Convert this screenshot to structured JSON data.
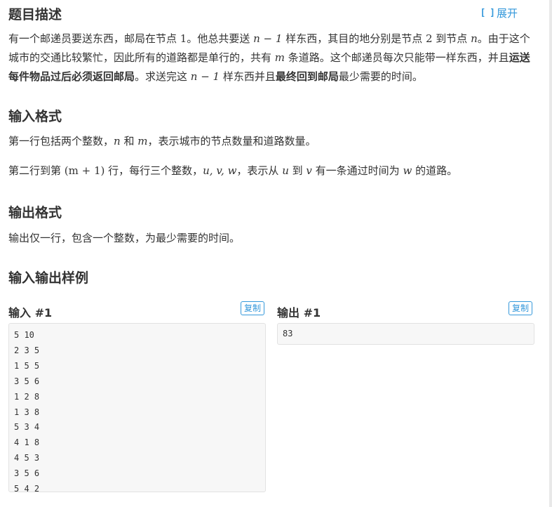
{
  "expand_label": "展开",
  "sections": {
    "description": {
      "title": "题目描述",
      "p1_a": "有一个邮递员要送东西，邮局在节点 ",
      "p1_m1": "1",
      "p1_b": "。他总共要送 ",
      "p1_m2": "n − 1",
      "p1_c": " 样东西，其目的地分别是节点 ",
      "p1_m3": "2",
      "p1_d": " 到节点 ",
      "p1_m4": "n",
      "p1_e": "。由于这个城市的交通比较繁忙，因此所有的道路都是单行的，共有 ",
      "p1_m5": "m",
      "p1_f": " 条道路。这个邮递员每次只能带一样东西，并且",
      "p1_bold1": "运送每件物品过后必须返回邮局",
      "p1_g": "。求送完这 ",
      "p1_m6": "n − 1",
      "p1_h": " 样东西并且",
      "p1_bold2": "最终回到邮局",
      "p1_i": "最少需要的时间。"
    },
    "input_format": {
      "title": "输入格式",
      "l1_a": "第一行包括两个整数，",
      "l1_m1": "n",
      "l1_b": " 和 ",
      "l1_m2": "m",
      "l1_c": "，表示城市的节点数量和道路数量。",
      "l2_a": "第二行到第 ",
      "l2_m1": "(m + 1)",
      "l2_b": " 行，每行三个整数，",
      "l2_m2": "u, v, w",
      "l2_c": "，表示从 ",
      "l2_m3": "u",
      "l2_d": " 到 ",
      "l2_m4": "v",
      "l2_e": " 有一条通过时间为 ",
      "l2_m5": "w",
      "l2_f": " 的道路。"
    },
    "output_format": {
      "title": "输出格式",
      "text": "输出仅一行，包含一个整数，为最少需要的时间。"
    },
    "samples": {
      "title": "输入输出样例",
      "input_label": "输入 #1",
      "output_label": "输出 #1",
      "copy_label": "复制",
      "input_text": "5 10\n2 3 5\n1 5 5\n3 5 6\n1 2 8\n1 3 8\n5 3 4\n4 1 8\n4 5 3\n3 5 6\n5 4 2",
      "output_text": "83"
    }
  }
}
